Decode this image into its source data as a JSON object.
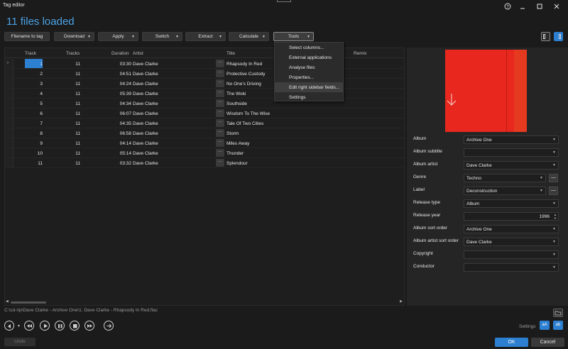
{
  "window": {
    "title": "Tag editor"
  },
  "headline": "11 files loaded",
  "toolbar": {
    "filename_to_tag": "Filename to tag",
    "download": "Download",
    "apply": "Apply",
    "switch": "Switch",
    "extract": "Extract",
    "calculate": "Calculate",
    "tools": "Tools"
  },
  "grid": {
    "columns": {
      "track": "Track",
      "tracks": "Tracks",
      "duration": "Duration",
      "artist": "Artist",
      "title": "Title",
      "remix": "Remix"
    },
    "rows": [
      {
        "track": "1",
        "tracks": "11",
        "duration": "03:30",
        "artist": "Dave Clarke",
        "title": "Rhapsody In Red"
      },
      {
        "track": "2",
        "tracks": "11",
        "duration": "04:51",
        "artist": "Dave Clarke",
        "title": "Protective Custody"
      },
      {
        "track": "3",
        "tracks": "11",
        "duration": "04:24",
        "artist": "Dave Clarke",
        "title": "No One's Driving"
      },
      {
        "track": "4",
        "tracks": "11",
        "duration": "05:39",
        "artist": "Dave Clarke",
        "title": "The Woki"
      },
      {
        "track": "5",
        "tracks": "11",
        "duration": "04:34",
        "artist": "Dave Clarke",
        "title": "Southside"
      },
      {
        "track": "6",
        "tracks": "11",
        "duration": "06:07",
        "artist": "Dave Clarke",
        "title": "Wisdom To The Wise"
      },
      {
        "track": "7",
        "tracks": "11",
        "duration": "04:35",
        "artist": "Dave Clarke",
        "title": "Tale Of Two Cities"
      },
      {
        "track": "8",
        "tracks": "11",
        "duration": "06:58",
        "artist": "Dave Clarke",
        "title": "Storm"
      },
      {
        "track": "9",
        "tracks": "11",
        "duration": "04:14",
        "artist": "Dave Clarke",
        "title": "Miles Away"
      },
      {
        "track": "10",
        "tracks": "11",
        "duration": "05:14",
        "artist": "Dave Clarke",
        "title": "Thunder"
      },
      {
        "track": "11",
        "tracks": "11",
        "duration": "03:32",
        "artist": "Dave Clarke",
        "title": "Splendour"
      }
    ],
    "cell_button": "···"
  },
  "tools_menu": {
    "items": [
      "Select columns...",
      "External applications",
      "Analyse files",
      "Properties...",
      "Edit right sidebar fields...",
      "Settings"
    ]
  },
  "sidebar": {
    "fields": [
      {
        "label": "Album",
        "value": "Archive One"
      },
      {
        "label": "Album subtitle",
        "value": ""
      },
      {
        "label": "Album artist",
        "value": "Dave Clarke"
      },
      {
        "label": "Genre",
        "value": "Techno"
      },
      {
        "label": "Label",
        "value": "Deconstruction"
      },
      {
        "label": "Release type",
        "value": "Album"
      },
      {
        "label": "Release year",
        "value": "1996"
      },
      {
        "label": "Album sort order",
        "value": "Archive One"
      },
      {
        "label": "Album artist sort order",
        "value": "Dave Clarke"
      },
      {
        "label": "Copyright",
        "value": ""
      },
      {
        "label": "Conductor",
        "value": ""
      }
    ],
    "minus_label": "—"
  },
  "status": {
    "path": "C:\\cd-rip\\Dave Clarke - Archive One\\1. Dave Clarke - Rhapsody In Red.flac"
  },
  "footer": {
    "settings": "Settings",
    "btn_a": "aA",
    "btn_b": "ab",
    "undo": "Undo",
    "ok": "OK",
    "cancel": "Cancel"
  },
  "colors": {
    "accent": "#2d7fd1",
    "headline": "#4aa3e6",
    "cover": "#e8281e"
  }
}
